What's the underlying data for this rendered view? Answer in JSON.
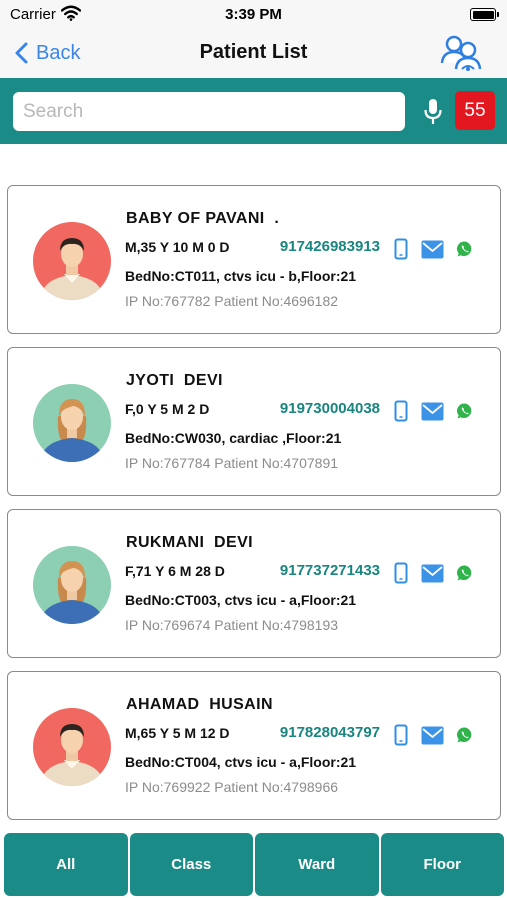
{
  "status_bar": {
    "carrier": "Carrier",
    "time": "3:39 PM"
  },
  "nav": {
    "back_label": "Back",
    "title": "Patient List",
    "right_icon": "doctors-icon"
  },
  "search": {
    "placeholder": "Search",
    "mic_icon": "mic-icon",
    "count": "55"
  },
  "patients": [
    {
      "name": "BABY OF PAVANI  .",
      "age": "M,35 Y 10 M 0 D",
      "phone": "917426983913",
      "bed": "BedNo:CT011, ctvs icu - b,Floor:21",
      "ip": "IP No:767782 Patient No:4696182",
      "gender": "male"
    },
    {
      "name": "JYOTI  DEVI",
      "age": "F,0 Y 5 M 2 D",
      "phone": "919730004038",
      "bed": "BedNo:CW030, cardiac ,Floor:21",
      "ip": "IP No:767784 Patient No:4707891",
      "gender": "female"
    },
    {
      "name": "RUKMANI  DEVI",
      "age": "F,71 Y 6 M 28 D",
      "phone": "917737271433",
      "bed": "BedNo:CT003, ctvs icu - a,Floor:21",
      "ip": "IP No:769674 Patient No:4798193",
      "gender": "female"
    },
    {
      "name": "AHAMAD  HUSAIN",
      "age": "M,65 Y 5 M 12 D",
      "phone": "917828043797",
      "bed": "BedNo:CT004, ctvs icu - a,Floor:21",
      "ip": "IP No:769922 Patient No:4798966",
      "gender": "male"
    }
  ],
  "filters": [
    "All",
    "Class",
    "Ward",
    "Floor"
  ],
  "colors": {
    "teal": "#1a8b86",
    "badge_red": "#e3171f",
    "link_blue": "#3a86e8",
    "male_avatar_bg": "#f0685f",
    "female_avatar_bg": "#8ccfb2",
    "whatsapp_green": "#2fb34a"
  }
}
